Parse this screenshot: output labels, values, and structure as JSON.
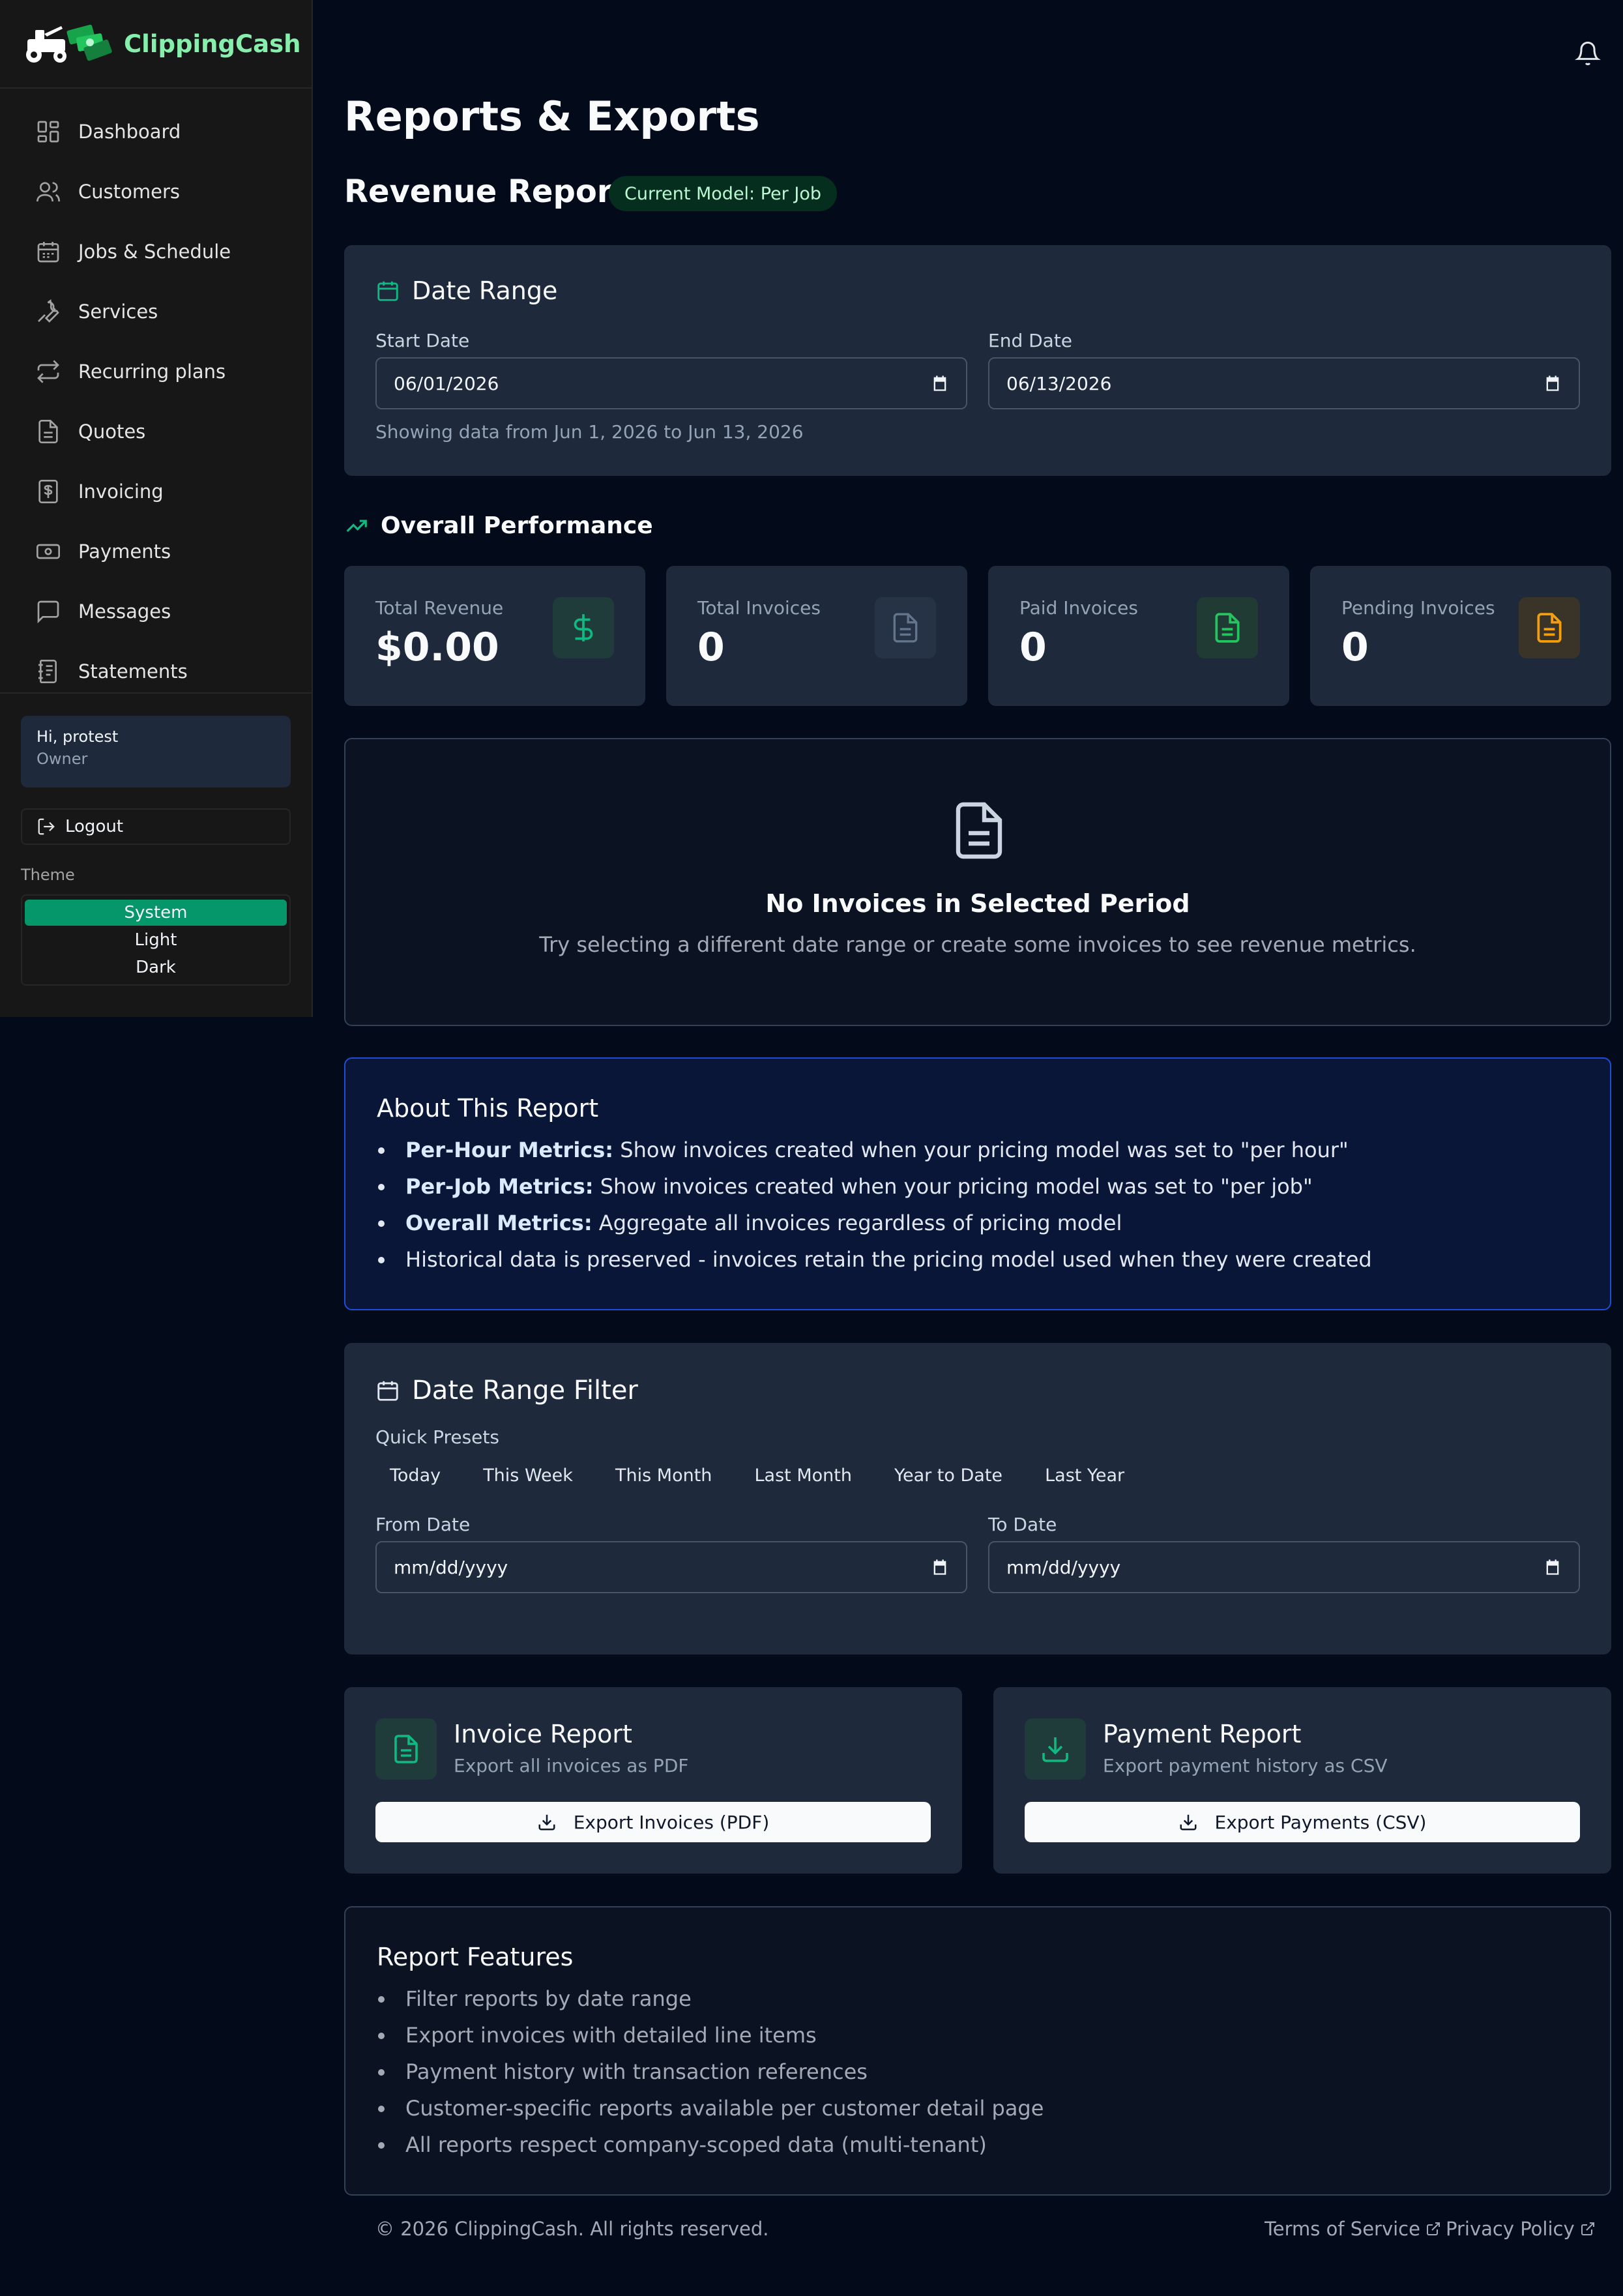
{
  "brand": {
    "name": "ClippingCash"
  },
  "sidebar": {
    "items": [
      {
        "label": "Dashboard",
        "icon": "dashboard-icon"
      },
      {
        "label": "Customers",
        "icon": "users-icon"
      },
      {
        "label": "Jobs & Schedule",
        "icon": "calendar-icon"
      },
      {
        "label": "Services",
        "icon": "wrench-icon"
      },
      {
        "label": "Recurring plans",
        "icon": "repeat-icon"
      },
      {
        "label": "Quotes",
        "icon": "document-icon"
      },
      {
        "label": "Invoicing",
        "icon": "dollar-document-icon"
      },
      {
        "label": "Payments",
        "icon": "banknote-icon"
      },
      {
        "label": "Messages",
        "icon": "message-icon"
      },
      {
        "label": "Statements",
        "icon": "receipt-icon"
      }
    ],
    "user": {
      "greeting": "Hi, protest",
      "role": "Owner"
    },
    "logout_label": "Logout",
    "theme_label": "Theme",
    "theme_options": [
      "System",
      "Light",
      "Dark"
    ],
    "theme_selected": "System"
  },
  "page": {
    "title": "Reports & Exports",
    "revenue_title": "Revenue Report",
    "model_badge": "Current Model: Per Job"
  },
  "date_range": {
    "title": "Date Range",
    "start_label": "Start Date",
    "start_value": "06/01/2026",
    "end_label": "End Date",
    "end_value": "06/13/2026",
    "summary": "Showing data from Jun 1, 2026 to Jun 13, 2026"
  },
  "performance": {
    "title": "Overall Performance",
    "stats": [
      {
        "label": "Total Revenue",
        "value": "$0.00",
        "icon": "dollar-icon",
        "color": "#10b981"
      },
      {
        "label": "Total Invoices",
        "value": "0",
        "icon": "document-icon",
        "color": "#64748b"
      },
      {
        "label": "Paid Invoices",
        "value": "0",
        "icon": "document-icon",
        "color": "#22c55e"
      },
      {
        "label": "Pending Invoices",
        "value": "0",
        "icon": "document-icon",
        "color": "#f59e0b"
      }
    ]
  },
  "empty_state": {
    "title": "No Invoices in Selected Period",
    "message": "Try selecting a different date range or create some invoices to see revenue metrics."
  },
  "about": {
    "title": "About This Report",
    "items": [
      {
        "bold": "Per-Hour Metrics:",
        "text": " Show invoices created when your pricing model was set to \"per hour\""
      },
      {
        "bold": "Per-Job Metrics:",
        "text": " Show invoices created when your pricing model was set to \"per job\""
      },
      {
        "bold": "Overall Metrics:",
        "text": " Aggregate all invoices regardless of pricing model"
      },
      {
        "bold": "",
        "text": "Historical data is preserved - invoices retain the pricing model used when they were created"
      }
    ]
  },
  "filter": {
    "title": "Date Range Filter",
    "presets_label": "Quick Presets",
    "presets": [
      "Today",
      "This Week",
      "This Month",
      "Last Month",
      "Year to Date",
      "Last Year"
    ],
    "from_label": "From Date",
    "from_placeholder": "mm/dd/yyyy",
    "to_label": "To Date",
    "to_placeholder": "mm/dd/yyyy"
  },
  "exports": [
    {
      "title": "Invoice Report",
      "subtitle": "Export all invoices as PDF",
      "button": "Export Invoices (PDF)",
      "icon": "document-icon"
    },
    {
      "title": "Payment Report",
      "subtitle": "Export payment history as CSV",
      "button": "Export Payments (CSV)",
      "icon": "download-icon"
    }
  ],
  "features": {
    "title": "Report Features",
    "items": [
      "Filter reports by date range",
      "Export invoices with detailed line items",
      "Payment history with transaction references",
      "Customer-specific reports available per customer detail page",
      "All reports respect company-scoped data (multi-tenant)"
    ]
  },
  "footer": {
    "copyright": "© 2026 ClippingCash. All rights reserved.",
    "terms": "Terms of Service",
    "privacy": "Privacy Policy"
  }
}
